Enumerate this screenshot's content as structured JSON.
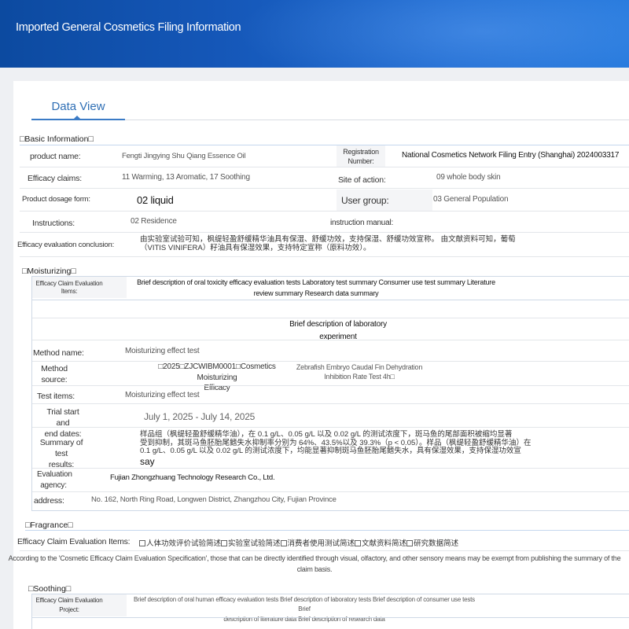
{
  "header": {
    "title": "Imported General Cosmetics Filing Information"
  },
  "tab": {
    "label": "Data View"
  },
  "basic": {
    "section_title": "□Basic Information□",
    "product_name_label": "product name:",
    "product_name_value": "Fengti Jingying Shu Qiang Essence Oil",
    "registration_label_1": "Registration",
    "registration_label_2": "Number:",
    "registration_value": "National Cosmetics Network Filing Entry (Shanghai) 2024003317",
    "efficacy_claims_label": "Efficacy claims:",
    "efficacy_claims_value": "11 Warming, 13 Aromatic, 17 Soothing",
    "site_label": "Site of action:",
    "site_value": "09 whole body skin",
    "dosage_label": "Product dosage form:",
    "dosage_value": "02 liquid",
    "user_group_label": "User group:",
    "user_group_value": "03 General Population",
    "instructions_label": "Instructions:",
    "instructions_value": "02 Residence",
    "manual_label": "instruction manual:",
    "conclusion_label": "Efficacy evaluation conclusion:",
    "conclusion_line_1": "由实验室试验可知，枫缇轻盈舒缓精华油具有保湿、舒缓功效，支持保湿、舒缓功效宣称。 由文献资料可知，葡萄",
    "conclusion_line_2": "（VITIS VINIFERA）籽油具有保湿效果，支持特定宣称（原料功效）。"
  },
  "moisturizing": {
    "section_title": "□Moisturizing□",
    "claim_items_label_1": "Efficacy Claim Evaluation",
    "claim_items_label_2": "Items:",
    "claim_items_line_1": "Brief description of oral toxicity efficacy evaluation tests Laboratory test summary Consumer use test summary Literature",
    "claim_items_line_2": "review summary Research data summary",
    "lab_brief_1": "Brief description of laboratory",
    "lab_brief_2": "experiment",
    "method_name_label": "Method name:",
    "method_name_value": "Moisturizing effect test",
    "method_source_label_1": "Method",
    "method_source_label_2": "source:",
    "method_source_value_1": "□2025□ZJCWIBM0001□Cosmetics Moisturizing",
    "method_source_value_2": "Efficacy",
    "method_source_value_3": "Zebrafish Embryo Caudal Fin Dehydration",
    "method_source_value_4": "Inhibition Rate Test 4h□",
    "test_items_label": "Test items:",
    "test_items_value": "Moisturizing effect test",
    "trial_label_1": "Trial start and",
    "trial_label_2": "end dates:",
    "trial_value": "July 1, 2025 - July 14, 2025",
    "summary_label_1": "Summary of test",
    "summary_label_2": "results:",
    "summary_line_1": "样品组（枫缇轻盈舒缓精华油），在 0.1 g/L、0.05 g/L 以及 0.02 g/L 的测试浓度下，斑马鱼的尾部面积被缩均显著",
    "summary_line_2": "受到抑制，其斑马鱼胚胎尾鳍失水抑制率分别为 64%、43.5%以及 39.3%（p < 0.05）。样品（枫缇轻盈舒缓精华油）在",
    "summary_line_3": "0.1 g/L、0.05 g/L 以及 0.02 g/L 的测试浓度下，均能显著抑制斑马鱼胚胎尾鳍失水，具有保湿效果，支持保湿功效宣",
    "summary_line_4": "say",
    "agency_label_1": "Evaluation",
    "agency_label_2": "agency:",
    "agency_value": "Fujian Zhongzhuang Technology Research Co., Ltd.",
    "address_label": "address:",
    "address_value": "No. 162, North Ring Road, Longwen District, Zhangzhou City, Fujian Province"
  },
  "fragrance": {
    "section_title": "□Fragrance□",
    "claim_items_label": "Efficacy Claim Evaluation Items:",
    "checkboxes": [
      "人体功效评价试验简述",
      "实验室试验简述",
      "消费者使用测试简述",
      "文献资料简述",
      "研究数据简述"
    ],
    "note_line_1": "According to the 'Cosmetic Efficacy Claim Evaluation Specification', those that can be directly identified through visual, olfactory, and other sensory means may be exempt from publishing the summary of the",
    "note_line_2": "claim basis."
  },
  "soothing": {
    "section_title": "□Soothing□",
    "claim_label_1": "Efficacy Claim Evaluation",
    "claim_label_2": "Project:",
    "claim_line_1": "Brief description of oral human efficacy evaluation tests Brief description of laboratory tests Brief description of consumer use tests Brief",
    "claim_line_2": "description of literature data Brief description of research data"
  }
}
